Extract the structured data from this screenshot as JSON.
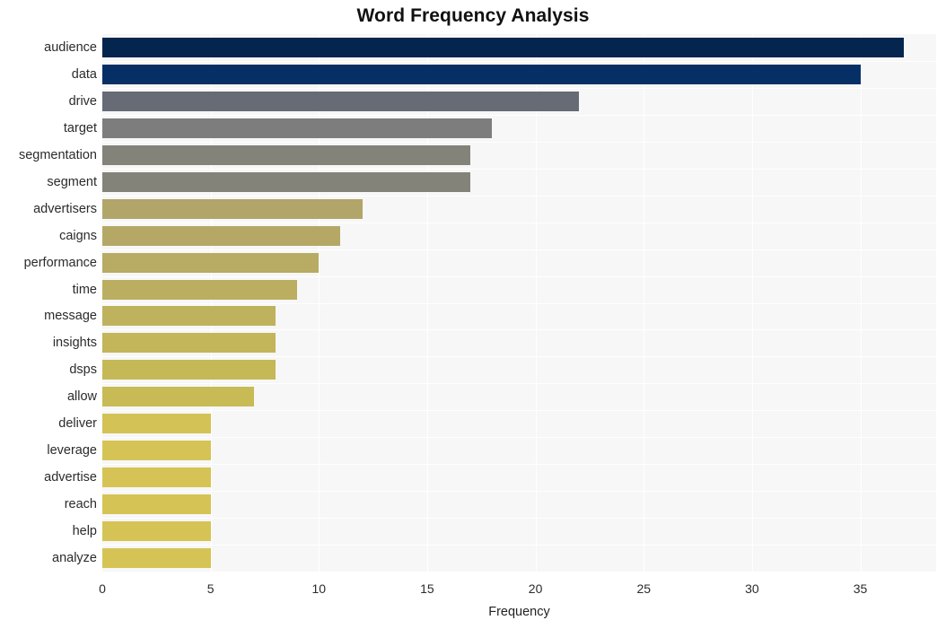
{
  "chart_data": {
    "type": "bar",
    "orientation": "horizontal",
    "title": "Word Frequency Analysis",
    "xlabel": "Frequency",
    "ylabel": "",
    "xlim": [
      0,
      38.5
    ],
    "xticks": [
      0,
      5,
      10,
      15,
      20,
      25,
      30,
      35
    ],
    "grid": true,
    "legend_position": "none",
    "categories": [
      "audience",
      "data",
      "drive",
      "target",
      "segmentation",
      "segment",
      "advertisers",
      "caigns",
      "performance",
      "time",
      "message",
      "insights",
      "dsps",
      "allow",
      "deliver",
      "leverage",
      "advertise",
      "reach",
      "help",
      "analyze"
    ],
    "values": [
      37,
      35,
      22,
      18,
      17,
      17,
      12,
      11,
      10,
      9,
      8,
      8,
      8,
      7,
      5,
      5,
      5,
      5,
      5,
      5
    ],
    "bar_colors": [
      "#04254e",
      "#063065",
      "#666b76",
      "#7d7d7d",
      "#83837a",
      "#83837a",
      "#b2a569",
      "#b5a866",
      "#b8ab63",
      "#bbae60",
      "#bfb25d",
      "#c2b55a",
      "#c5b857",
      "#c8bb55",
      "#d3c256",
      "#d5c455",
      "#d5c455",
      "#d5c455",
      "#d5c455",
      "#d5c455"
    ]
  },
  "style": {
    "plot_background": "#f7f7f7",
    "page_background": "#ffffff",
    "gridline_color": "#ffffff",
    "tick_label_color": "#2b2b2b",
    "title_color": "#111111"
  }
}
